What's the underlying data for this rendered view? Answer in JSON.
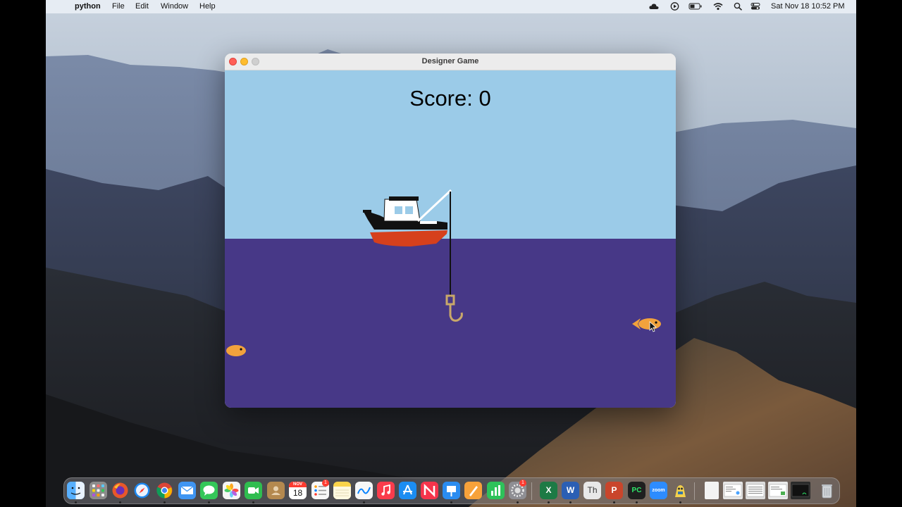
{
  "menubar": {
    "apple_glyph": "",
    "app_name": "python",
    "items": [
      "File",
      "Edit",
      "Window",
      "Help"
    ],
    "clock": "Sat Nov 18  10:52 PM",
    "status_icons": [
      "cloud-icon",
      "play-icon",
      "battery-icon",
      "wifi-icon",
      "search-icon",
      "control-center-icon"
    ]
  },
  "window": {
    "title": "Designer Game"
  },
  "game": {
    "score_label": "Score: 0",
    "colors": {
      "sky": "#9bcbe8",
      "water": "#473887",
      "boat_hull": "#d6401c",
      "boat_band": "#111111",
      "cabin": "#ffffff",
      "fish": "#f2a23c",
      "hook": "#c9a86a"
    }
  },
  "dock": {
    "calendar_month": "NOV",
    "calendar_day": "18",
    "reminders_badge": "1",
    "settings_badge": "1",
    "items": [
      {
        "name": "finder-icon",
        "label": "",
        "color": "#3d8ef0"
      },
      {
        "name": "launchpad-icon",
        "label": "",
        "color": "#8c8c8c"
      },
      {
        "name": "firefox-icon",
        "label": "",
        "color": "#e8582a"
      },
      {
        "name": "safari-icon",
        "label": "",
        "color": "#1d88f0"
      },
      {
        "name": "chrome-icon",
        "label": "",
        "color": "#e9e9e9"
      },
      {
        "name": "mail-icon",
        "label": "",
        "color": "#3f95f2"
      },
      {
        "name": "messages-icon",
        "label": "",
        "color": "#34c759"
      },
      {
        "name": "photos-icon",
        "label": "",
        "color": "#f5f5f5"
      },
      {
        "name": "facetime-icon",
        "label": "",
        "color": "#2fbd4f"
      },
      {
        "name": "contacts-icon",
        "label": "",
        "color": "#b4894f"
      },
      {
        "name": "calendar-icon",
        "label": "",
        "color": "#ffffff"
      },
      {
        "name": "reminders-icon",
        "label": "",
        "color": "#f8f8f8"
      },
      {
        "name": "notes-icon",
        "label": "",
        "color": "#fbd44a"
      },
      {
        "name": "freeform-icon",
        "label": "",
        "color": "#f7f7f7"
      },
      {
        "name": "music-icon",
        "label": "",
        "color": "#fa3c4c"
      },
      {
        "name": "app-store-icon",
        "label": "",
        "color": "#1b8df2"
      },
      {
        "name": "news-icon",
        "label": "",
        "color": "#f5344b"
      },
      {
        "name": "keynote-icon",
        "label": "",
        "color": "#2a8cf0"
      },
      {
        "name": "pages-icon",
        "label": "",
        "color": "#f7a23a"
      },
      {
        "name": "numbers-icon",
        "label": "",
        "color": "#2ec25a"
      },
      {
        "name": "system-settings-icon",
        "label": "",
        "color": "#8e8e93"
      },
      {
        "name": "excel-icon",
        "label": "X",
        "color": "#1d7a45"
      },
      {
        "name": "word-icon",
        "label": "W",
        "color": "#2b5fb4"
      },
      {
        "name": "font-book-icon",
        "label": "Th",
        "color": "#e8e8e8"
      },
      {
        "name": "powerpoint-icon",
        "label": "P",
        "color": "#c9452b"
      },
      {
        "name": "pycharm-icon",
        "label": "PC",
        "color": "#1f1f1f"
      },
      {
        "name": "zoom-icon",
        "label": "zoom",
        "color": "#2d8cff"
      },
      {
        "name": "python-launcher-icon",
        "label": "",
        "color": "#f3d04b"
      },
      {
        "name": "document-icon",
        "label": "",
        "color": "#f3f3f3"
      },
      {
        "name": "window-thumbnail-1-icon",
        "label": "",
        "color": "#e6e6e6"
      },
      {
        "name": "window-thumbnail-2-icon",
        "label": "",
        "color": "#dcdcdc"
      },
      {
        "name": "window-thumbnail-3-icon",
        "label": "",
        "color": "#eaeaea"
      },
      {
        "name": "terminal-icon",
        "label": "",
        "color": "#2b2b2b"
      },
      {
        "name": "trash-icon",
        "label": "",
        "color": "#d0d4d8"
      }
    ]
  }
}
